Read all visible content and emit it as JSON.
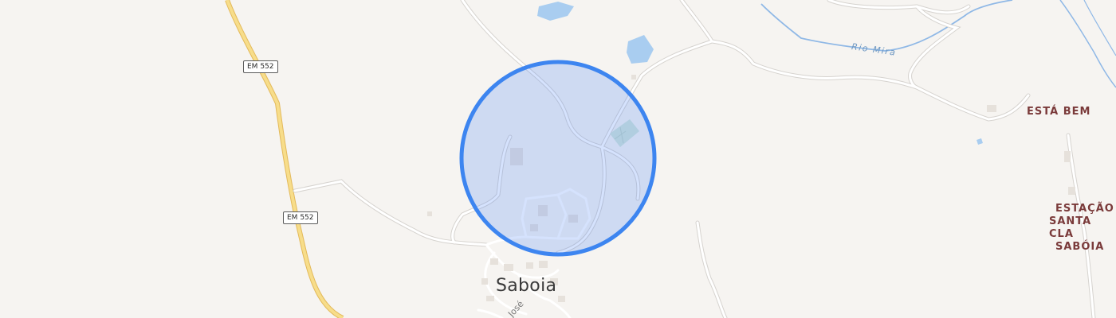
{
  "map": {
    "colors": {
      "background": "#f6f4f1",
      "road": "#ffffff",
      "road_casing": "#d6d3cf",
      "main_road": "#f7dd8a",
      "main_road_casing": "#e3b95a",
      "water": "#a9cdf0",
      "river": "#8fb8e6",
      "accuracy_fill": "#5b8ff9",
      "accuracy_stroke": "#3d85f0",
      "poi_text": "#7a3a3a"
    },
    "road_shields": [
      {
        "id": "em552-north",
        "label": "EM 552"
      },
      {
        "id": "em552-south",
        "label": "EM 552"
      }
    ],
    "places": {
      "town": "Saboia",
      "poi_esta_bem": "ESTÁ BEM",
      "station_line1": "ESTAÇÃO",
      "station_line2": "SANTA CLA",
      "station_line3": "SABÓIA"
    },
    "water": {
      "river_name": "Rio Mira"
    },
    "streets": {
      "partial": "José"
    },
    "location_marker": {
      "type": "accuracy-circle",
      "icon": "location-accuracy-icon"
    }
  }
}
